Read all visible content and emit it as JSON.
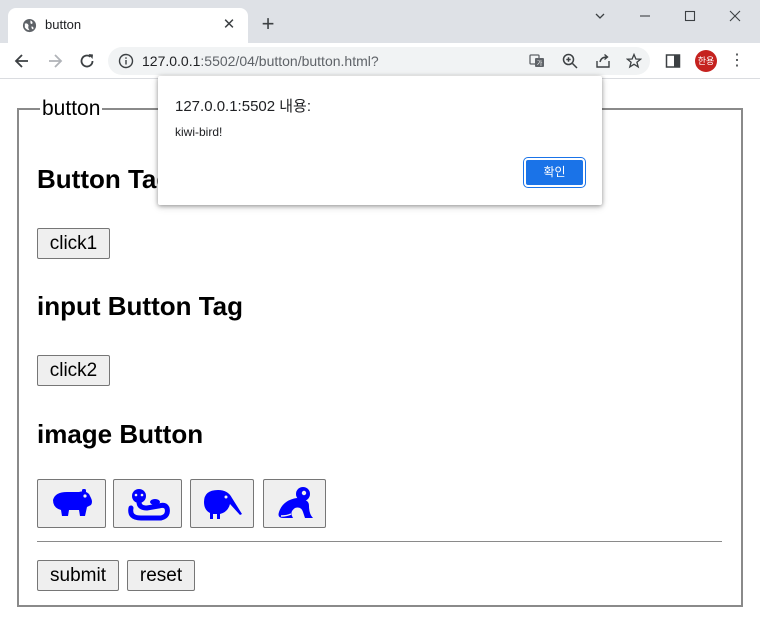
{
  "browser": {
    "tab_title": "button",
    "url_host": "127.0.0.1",
    "url_path": ":5502/04/button/button.html?",
    "profile_label": "한용"
  },
  "page": {
    "fieldset_legend": "button",
    "heading_button_tag": "Button Tag",
    "button_click1": "click1",
    "heading_input_button_tag": "input Button Tag",
    "button_click2": "click2",
    "heading_image_button": "image Button",
    "image_buttons": [
      {
        "icon": "hippo-icon"
      },
      {
        "icon": "otter-icon"
      },
      {
        "icon": "kiwi-bird-icon"
      },
      {
        "icon": "frog-icon"
      }
    ],
    "submit_label": "submit",
    "reset_label": "reset",
    "icon_color": "#0000ff"
  },
  "dialog": {
    "title": "127.0.0.1:5502 내용:",
    "message": "kiwi-bird!",
    "ok_label": "확인",
    "ok_color": "#1a73e8"
  }
}
